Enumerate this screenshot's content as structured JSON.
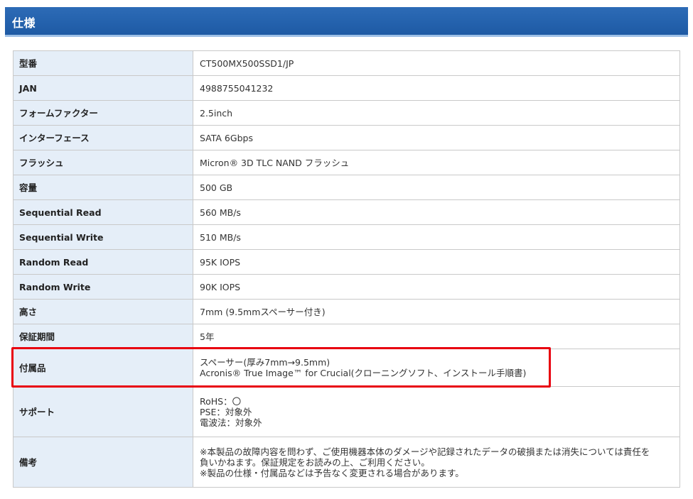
{
  "header": {
    "title": "仕様"
  },
  "spec": {
    "rows": [
      {
        "label": "型番",
        "lines": [
          "CT500MX500SSD1/JP"
        ]
      },
      {
        "label": "JAN",
        "lines": [
          "4988755041232"
        ]
      },
      {
        "label": "フォームファクター",
        "lines": [
          "2.5inch"
        ]
      },
      {
        "label": "インターフェース",
        "lines": [
          "SATA 6Gbps"
        ]
      },
      {
        "label": "フラッシュ",
        "lines": [
          "Micron® 3D TLC NAND フラッシュ"
        ]
      },
      {
        "label": "容量",
        "lines": [
          "500 GB"
        ]
      },
      {
        "label": "Sequential Read",
        "lines": [
          "560 MB/s"
        ]
      },
      {
        "label": "Sequential Write",
        "lines": [
          "510 MB/s"
        ]
      },
      {
        "label": "Random Read",
        "lines": [
          "95K IOPS"
        ]
      },
      {
        "label": "Random Write",
        "lines": [
          "90K IOPS"
        ]
      },
      {
        "label": "高さ",
        "lines": [
          "7mm (9.5mmスペーサー付き)"
        ]
      },
      {
        "label": "保証期間",
        "lines": [
          "5年"
        ]
      },
      {
        "label": "付属品",
        "lines": [
          "スペーサー(厚み7mm→9.5mm)",
          "Acronis® True Image™ for Crucial(クローニングソフト、インストール手順書)"
        ]
      },
      {
        "label": "サポート",
        "lines": [
          "RoHS：〇",
          "PSE：対象外",
          "電波法：対象外"
        ]
      },
      {
        "label": "備考",
        "lines": [
          "※本製品の故障内容を問わず、ご使用機器本体のダメージや記録されたデータの破損または消失については責任を",
          "負いかねます。保証規定をお読みの上、ご利用ください。",
          "※製品の仕様・付属品などは予告なく変更される場合があります。"
        ]
      }
    ]
  },
  "annotation": {
    "highlight_color": "#e8000f"
  },
  "colors": {
    "header_blue": "#2462ad",
    "label_bg": "#e5eef8",
    "border": "#c9c9c9"
  }
}
